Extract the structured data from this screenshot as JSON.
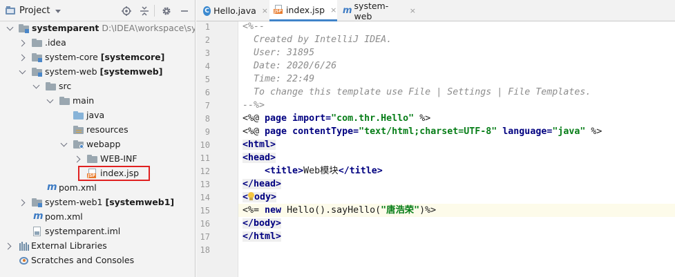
{
  "project_panel": {
    "title": "Project",
    "tools": [
      "locate-icon",
      "collapse-icon",
      "gear-icon",
      "minimize-icon"
    ],
    "tree": [
      {
        "name": "systemparent",
        "path": "D:\\IDEA\\workspace\\syste",
        "bold": true
      },
      {
        "name": ".idea"
      },
      {
        "name": "system-core",
        "module": "[systemcore]"
      },
      {
        "name": "system-web",
        "module": "[systemweb]"
      },
      {
        "name": "src"
      },
      {
        "name": "main"
      },
      {
        "name": "java"
      },
      {
        "name": "resources"
      },
      {
        "name": "webapp"
      },
      {
        "name": "WEB-INF"
      },
      {
        "name": "index.jsp"
      },
      {
        "name": "pom.xml"
      },
      {
        "name": "system-web1",
        "module": "[systemweb1]"
      },
      {
        "name": "pom.xml"
      },
      {
        "name": "systemparent.iml"
      },
      {
        "name": "External Libraries"
      },
      {
        "name": "Scratches and Consoles"
      }
    ]
  },
  "editor": {
    "tabs": [
      {
        "label": "Hello.java",
        "icon": "class-icon",
        "active": false
      },
      {
        "label": "index.jsp",
        "icon": "jsp-icon",
        "active": true
      },
      {
        "label": "system-web",
        "icon": "maven-icon",
        "active": false
      }
    ],
    "close_glyph": "×",
    "line_numbers": [
      "1",
      "2",
      "3",
      "4",
      "5",
      "6",
      "7",
      "8",
      "9",
      "10",
      "11",
      "12",
      "13",
      "14",
      "15",
      "16",
      "17",
      "18"
    ],
    "code": {
      "l1": "<%--",
      "l2": "  Created by IntelliJ IDEA.",
      "l3": "  User: 31895",
      "l4": "  Date: 2020/6/26",
      "l5": "  Time: 22:49",
      "l6": "  To change this template use File | Settings | File Templates.",
      "l7": "--%>",
      "l8": {
        "open": "<%@ ",
        "kw1": "page",
        "a1": " import=",
        "s1": "\"com.thr.Hello\"",
        "close": " %>"
      },
      "l9": {
        "open": "<%@ ",
        "kw1": "page",
        "a1": " contentType=",
        "s1": "\"text/html;charset=UTF-8\"",
        "a2": " language=",
        "s2": "\"java\"",
        "close": " %>"
      },
      "l10": "<html>",
      "l11": "<head>",
      "l12": {
        "indent": "    ",
        "open": "<title>",
        "text": "Web模块",
        "close": "</title>"
      },
      "l13": "</head>",
      "l14": {
        "open": "<",
        "rest": "ody>"
      },
      "l15": {
        "open": "<%= ",
        "kw": "new",
        "call": " Hello().sayHello(",
        "s": "\"唐浩荣\"",
        "close": ")%>"
      },
      "l16": "</body>",
      "l17": "</html>"
    }
  },
  "colors": {
    "keyword": "#000080",
    "string": "#067d17",
    "comment": "#8c8c8c",
    "selection_box": "#e02020",
    "active_tab_underline": "#4083c9"
  }
}
